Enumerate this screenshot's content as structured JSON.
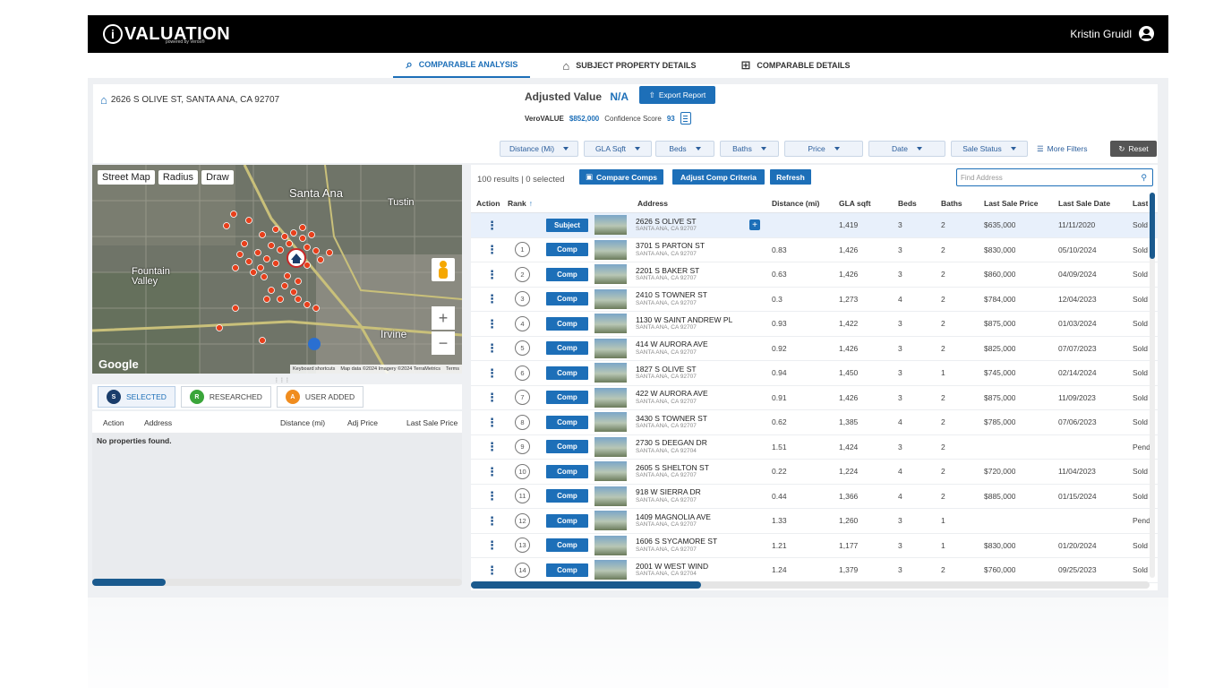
{
  "app": {
    "logo_text": "VALUATION",
    "logo_badge": "i",
    "logo_sub": "powered by Veros®",
    "user_name": "Kristin Gruidl"
  },
  "tabs": [
    {
      "label": "COMPARABLE ANALYSIS",
      "icon": "magnify-house-icon",
      "active": true
    },
    {
      "label": "SUBJECT PROPERTY DETAILS",
      "icon": "house-icon",
      "active": false
    },
    {
      "label": "COMPARABLE DETAILS",
      "icon": "tree-structure-icon",
      "active": false
    }
  ],
  "header": {
    "address": "2626 S OLIVE ST, SANTA ANA, CA 92707",
    "adjusted_value_label": "Adjusted Value",
    "adjusted_value": "N/A",
    "export_label": "Export Report",
    "verovalue_label": "VeroVALUE",
    "verovalue": "$852,000",
    "confidence_label": "Confidence Score",
    "confidence": "93"
  },
  "filters": {
    "items": [
      "Distance (Mi)",
      "GLA Sqft",
      "Beds",
      "Baths",
      "Price",
      "Date",
      "Sale Status"
    ],
    "more_label": "More Filters",
    "reset_label": "Reset"
  },
  "map": {
    "tools": [
      "Street Map",
      "Radius",
      "Draw"
    ],
    "labels": [
      "Santa Ana",
      "Fountain Valley",
      "Irvine",
      "Tustin"
    ],
    "google": "Google",
    "footer": [
      "Keyboard shortcuts",
      "Map data ©2024 Imagery ©2024 TerraMetrics",
      "Terms"
    ]
  },
  "status_tabs": [
    {
      "letter": "S",
      "label": "SELECTED",
      "color": "#1a3d6b",
      "active": true
    },
    {
      "letter": "R",
      "label": "RESEARCHED",
      "color": "#3aa53a",
      "active": false
    },
    {
      "letter": "A",
      "label": "USER ADDED",
      "color": "#f08c1e",
      "active": false
    }
  ],
  "left_table": {
    "columns": [
      "Action",
      "Address",
      "Distance (mi)",
      "Adj Price",
      "Last Sale Price"
    ],
    "empty": "No properties found."
  },
  "right": {
    "results": "100 results | 0 selected",
    "compare_label": "Compare Comps",
    "adjust_label": "Adjust Comp Criteria",
    "refresh_label": "Refresh",
    "find_placeholder": "Find Address",
    "columns": [
      "Action",
      "Rank",
      "Address",
      "Distance (mi)",
      "GLA sqft",
      "Beds",
      "Baths",
      "Last Sale Price",
      "Last Sale Date",
      "Last"
    ],
    "rows": [
      {
        "badge": "Subject",
        "rank": "",
        "street": "2626 S OLIVE ST",
        "city": "SANTA ANA, CA 92707",
        "dist": "",
        "gla": "1,419",
        "beds": "3",
        "baths": "2",
        "price": "$635,000",
        "date": "11/11/2020",
        "status": "Sold"
      },
      {
        "badge": "Comp",
        "rank": "1",
        "street": "3701 S PARTON ST",
        "city": "SANTA ANA, CA 92707",
        "dist": "0.83",
        "gla": "1,426",
        "beds": "3",
        "baths": "2",
        "price": "$830,000",
        "date": "05/10/2024",
        "status": "Sold"
      },
      {
        "badge": "Comp",
        "rank": "2",
        "street": "2201 S BAKER ST",
        "city": "SANTA ANA, CA 92707",
        "dist": "0.63",
        "gla": "1,426",
        "beds": "3",
        "baths": "2",
        "price": "$860,000",
        "date": "04/09/2024",
        "status": "Sold"
      },
      {
        "badge": "Comp",
        "rank": "3",
        "street": "2410 S TOWNER ST",
        "city": "SANTA ANA, CA 92707",
        "dist": "0.3",
        "gla": "1,273",
        "beds": "4",
        "baths": "2",
        "price": "$784,000",
        "date": "12/04/2023",
        "status": "Sold"
      },
      {
        "badge": "Comp",
        "rank": "4",
        "street": "1130 W SAINT ANDREW PL",
        "city": "SANTA ANA, CA 92707",
        "dist": "0.93",
        "gla": "1,422",
        "beds": "3",
        "baths": "2",
        "price": "$875,000",
        "date": "01/03/2024",
        "status": "Sold"
      },
      {
        "badge": "Comp",
        "rank": "5",
        "street": "414 W AURORA AVE",
        "city": "SANTA ANA, CA 92707",
        "dist": "0.92",
        "gla": "1,426",
        "beds": "3",
        "baths": "2",
        "price": "$825,000",
        "date": "07/07/2023",
        "status": "Sold"
      },
      {
        "badge": "Comp",
        "rank": "6",
        "street": "1827 S OLIVE ST",
        "city": "SANTA ANA, CA 92707",
        "dist": "0.94",
        "gla": "1,450",
        "beds": "3",
        "baths": "1",
        "price": "$745,000",
        "date": "02/14/2024",
        "status": "Sold"
      },
      {
        "badge": "Comp",
        "rank": "7",
        "street": "422 W AURORA AVE",
        "city": "SANTA ANA, CA 92707",
        "dist": "0.91",
        "gla": "1,426",
        "beds": "3",
        "baths": "2",
        "price": "$875,000",
        "date": "11/09/2023",
        "status": "Sold"
      },
      {
        "badge": "Comp",
        "rank": "8",
        "street": "3430 S TOWNER ST",
        "city": "SANTA ANA, CA 92707",
        "dist": "0.62",
        "gla": "1,385",
        "beds": "4",
        "baths": "2",
        "price": "$785,000",
        "date": "07/06/2023",
        "status": "Sold"
      },
      {
        "badge": "Comp",
        "rank": "9",
        "street": "2730 S DEEGAN DR",
        "city": "SANTA ANA, CA 92704",
        "dist": "1.51",
        "gla": "1,424",
        "beds": "3",
        "baths": "2",
        "price": "",
        "date": "",
        "status": "Pend"
      },
      {
        "badge": "Comp",
        "rank": "10",
        "street": "2605 S SHELTON ST",
        "city": "SANTA ANA, CA 92707",
        "dist": "0.22",
        "gla": "1,224",
        "beds": "4",
        "baths": "2",
        "price": "$720,000",
        "date": "11/04/2023",
        "status": "Sold"
      },
      {
        "badge": "Comp",
        "rank": "11",
        "street": "918 W SIERRA DR",
        "city": "SANTA ANA, CA 92707",
        "dist": "0.44",
        "gla": "1,366",
        "beds": "4",
        "baths": "2",
        "price": "$885,000",
        "date": "01/15/2024",
        "status": "Sold"
      },
      {
        "badge": "Comp",
        "rank": "12",
        "street": "1409 MAGNOLIA AVE",
        "city": "SANTA ANA, CA 92707",
        "dist": "1.33",
        "gla": "1,260",
        "beds": "3",
        "baths": "1",
        "price": "",
        "date": "",
        "status": "Pend"
      },
      {
        "badge": "Comp",
        "rank": "13",
        "street": "1606 S SYCAMORE ST",
        "city": "SANTA ANA, CA 92707",
        "dist": "1.21",
        "gla": "1,177",
        "beds": "3",
        "baths": "1",
        "price": "$830,000",
        "date": "01/20/2024",
        "status": "Sold"
      },
      {
        "badge": "Comp",
        "rank": "14",
        "street": "2001 W WEST WIND",
        "city": "SANTA ANA, CA 92704",
        "dist": "1.24",
        "gla": "1,379",
        "beds": "3",
        "baths": "2",
        "price": "$760,000",
        "date": "09/25/2023",
        "status": "Sold"
      }
    ]
  },
  "colors": {
    "accent": "#1d6fb8",
    "topbar": "#000000",
    "marker": "#e8401c"
  }
}
